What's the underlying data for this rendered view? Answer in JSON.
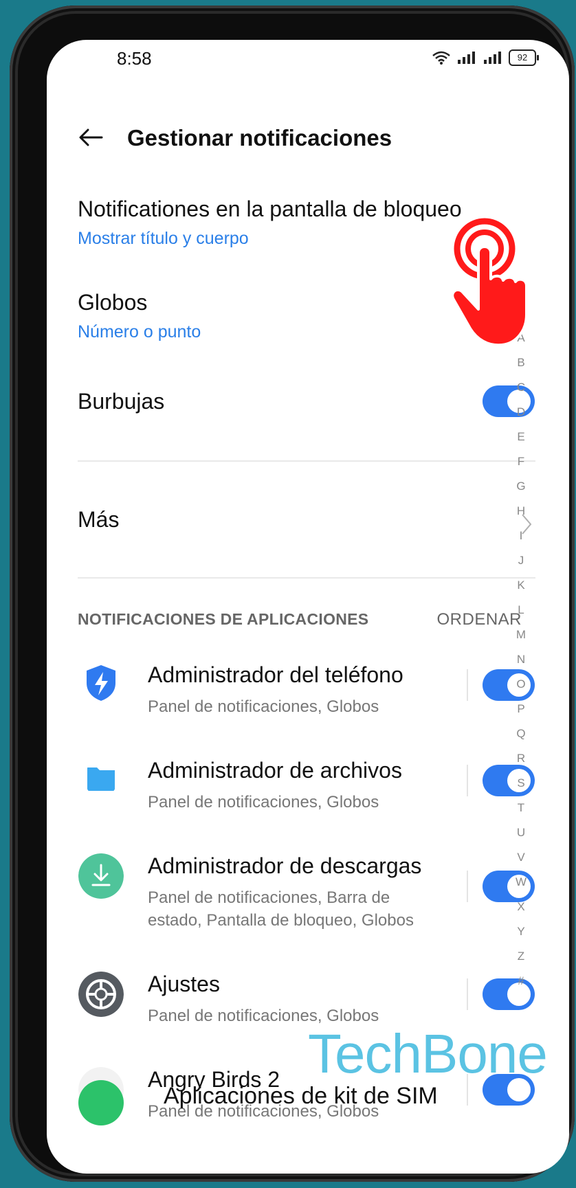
{
  "status": {
    "time": "8:58",
    "battery": "92"
  },
  "header": {
    "title": "Gestionar notificaciones"
  },
  "settings": {
    "lock_screen": {
      "title": "Notificationes en la pantalla de bloqueo",
      "value": "Mostrar título y cuerpo"
    },
    "badges": {
      "title": "Globos",
      "value": "Número o punto"
    },
    "bubbles": {
      "title": "Burbujas",
      "enabled": true
    },
    "more": {
      "title": "Más"
    }
  },
  "apps_section": {
    "header": "NOTIFICACIONES DE APLICACIONES",
    "sort_label": "ORDENAR",
    "apps": [
      {
        "name": "Administrador del teléfono",
        "detail": "Panel de notificaciones, Globos",
        "icon": "shield-lightning-icon",
        "enabled": true
      },
      {
        "name": "Administrador de archivos",
        "detail": "Panel de notificaciones, Globos",
        "icon": "folder-icon",
        "enabled": true
      },
      {
        "name": "Administrador de descargas",
        "detail": "Panel de notificaciones, Barra de estado, Pantalla de bloqueo, Globos",
        "icon": "download-icon",
        "enabled": true
      },
      {
        "name": "Ajustes",
        "detail": "Panel de notificaciones, Globos",
        "icon": "settings-gear-icon",
        "enabled": true
      },
      {
        "name": "Angry Birds 2",
        "detail": "Panel de notificaciones, Globos",
        "icon": "angry-birds-icon",
        "enabled": true
      }
    ],
    "partial_next": "Aplicaciones de kit de SIM"
  },
  "alpha_index": [
    "A",
    "B",
    "C",
    "D",
    "E",
    "F",
    "G",
    "H",
    "I",
    "J",
    "K",
    "L",
    "M",
    "N",
    "O",
    "P",
    "Q",
    "R",
    "S",
    "T",
    "U",
    "V",
    "W",
    "X",
    "Y",
    "Z",
    "#"
  ],
  "watermark": "TechBone",
  "colors": {
    "accent": "#2f7af0",
    "link": "#2a7fe8",
    "hand": "#ff1a1a",
    "background": "#1a7a8a"
  }
}
